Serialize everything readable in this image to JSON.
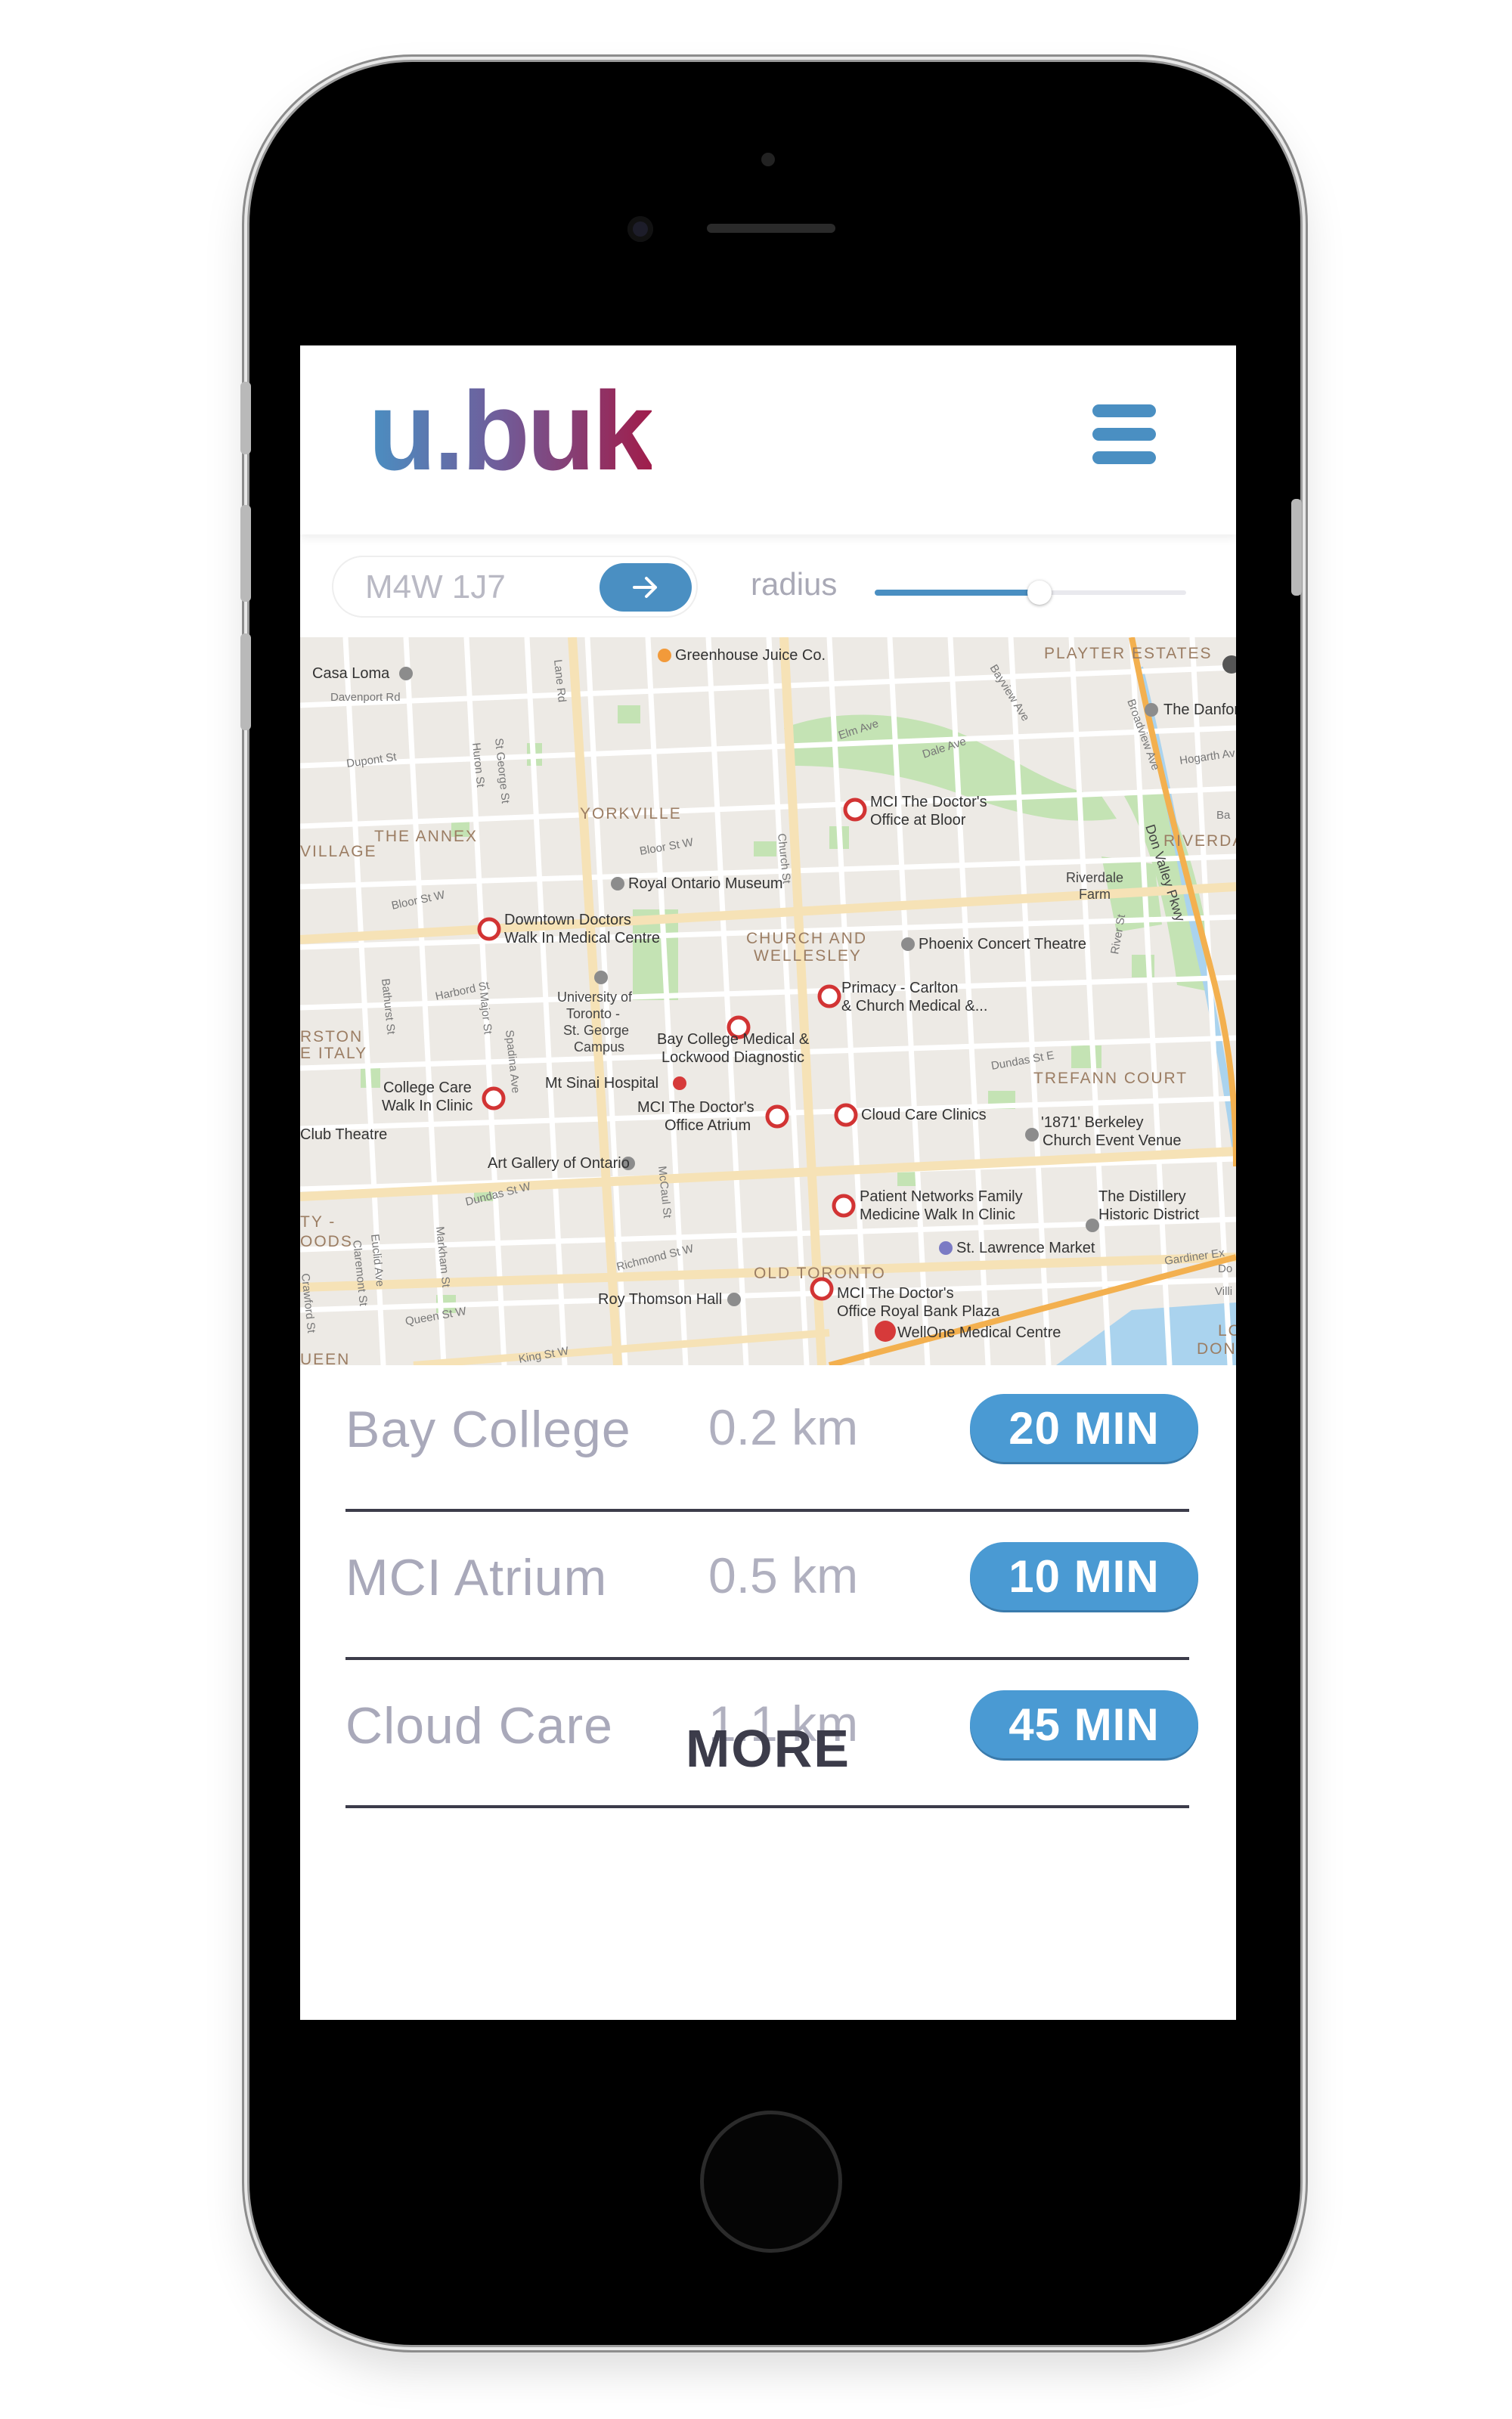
{
  "header": {
    "logo": "u.buk",
    "menu_icon": "hamburger-menu-icon"
  },
  "search": {
    "postal_value": "M4W 1J7",
    "go_icon": "arrow-right-icon",
    "radius_label": "radius",
    "radius_level": 0.53
  },
  "map": {
    "pois": [
      {
        "label": "Greenhouse Juice Co."
      },
      {
        "label": "Casa Loma"
      },
      {
        "label": "PLAYTER ESTATES"
      },
      {
        "label": "The Danforth"
      },
      {
        "label": "MCI The Doctor's",
        "label2": "Office at Bloor"
      },
      {
        "label": "Royal Ontario Museum"
      },
      {
        "label": "Downtown Doctors",
        "label2": "Walk In Medical Centre"
      },
      {
        "label": "Phoenix Concert Theatre"
      },
      {
        "label": "Primacy - Carlton",
        "label2": "& Church Medical &..."
      },
      {
        "label": "University of",
        "label2": "Toronto -",
        "label3": "St. George",
        "label4": "Campus"
      },
      {
        "label": "Bay College Medical &",
        "label2": "Lockwood Diagnostic"
      },
      {
        "label": "College Care",
        "label2": "Walk In Clinic"
      },
      {
        "label": "Mt Sinai Hospital"
      },
      {
        "label": "MCI The Doctor's",
        "label2": "Office Atrium"
      },
      {
        "label": "Cloud Care Clinics"
      },
      {
        "label": "'1871' Berkeley",
        "label2": "Church Event Venue"
      },
      {
        "label": "Art Gallery of Ontario"
      },
      {
        "label": "Patient Networks Family",
        "label2": "Medicine Walk In Clinic"
      },
      {
        "label": "The Distillery",
        "label2": "Historic District"
      },
      {
        "label": "St. Lawrence Market"
      },
      {
        "label": "Roy Thomson Hall"
      },
      {
        "label": "MCI The Doctor's",
        "label2": "Office Royal Bank Plaza"
      },
      {
        "label": "WellOne Medical Centre"
      },
      {
        "label": "Club Theatre"
      }
    ],
    "areas": [
      "THE ANNEX",
      "YORKVILLE",
      "CHURCH AND",
      "WELLESLEY",
      "VILLAGE",
      "RSTON",
      "E ITALY",
      "TREFANN COURT",
      "OLD TORONTO",
      "RIVERDA",
      "TY -",
      "OODS",
      "UEEN",
      "Riverdale",
      "Farm",
      "LO",
      "DON"
    ],
    "roads": [
      "Davenport Rd",
      "Dupont St",
      "Bloor St W",
      "Harbord St",
      "Dundas St W",
      "Queen St W",
      "King St W",
      "Richmond St W",
      "Elm Ave",
      "Dale Ave",
      "Bayview Ave",
      "Broadview Ave",
      "Don Valley Pkwy",
      "Dundas St E",
      "River St",
      "Gardiner Ex",
      "Bathurst St",
      "Spadina Ave",
      "Church St",
      "Bloor St W",
      "Hogarth Av",
      "Huron St",
      "St George St",
      "Major St",
      "Euclid Ave",
      "Markham St",
      "Crawford St",
      "Claremont St",
      "McCaul St",
      "Lane Rd",
      "Ba",
      "Do",
      "Villi"
    ]
  },
  "results": [
    {
      "name": "Bay College",
      "distance": "0.2 km",
      "time": "20 MIN"
    },
    {
      "name": "MCI Atrium",
      "distance": "0.5 km",
      "time": "10 MIN"
    },
    {
      "name": "Cloud Care",
      "distance": "1.1 km",
      "time": "45 MIN"
    }
  ],
  "more_label": "MORE",
  "colors": {
    "accent": "#4a9ad3",
    "logo_start": "#4a8fc2",
    "logo_end": "#a01d4b",
    "text_dark": "#3c3c4a"
  }
}
